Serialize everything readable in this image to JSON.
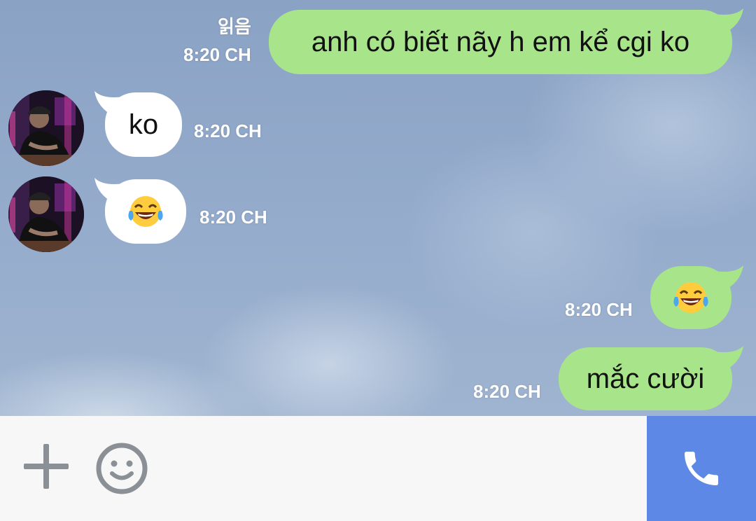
{
  "messages": [
    {
      "direction": "out",
      "text": "anh có biết nãy h em kể cgi ko",
      "time": "8:20 CH",
      "read_label": "읽음"
    },
    {
      "direction": "in",
      "text": "ko",
      "time": "8:20 CH"
    },
    {
      "direction": "in",
      "emoji": "face-with-tears-of-joy",
      "time": "8:20 CH"
    },
    {
      "direction": "out",
      "emoji": "face-with-tears-of-joy",
      "time": "8:20 CH"
    },
    {
      "direction": "out",
      "text": "mắc cười",
      "time": "8:20 CH"
    }
  ],
  "input_bar": {
    "icons": [
      "plus-icon",
      "smiley-icon"
    ],
    "call_icon": "phone-icon"
  },
  "colors": {
    "outgoing_bubble": "#a8e58a",
    "incoming_bubble": "#ffffff",
    "call_button": "#5d88e6",
    "background": "#8fa6c6"
  }
}
